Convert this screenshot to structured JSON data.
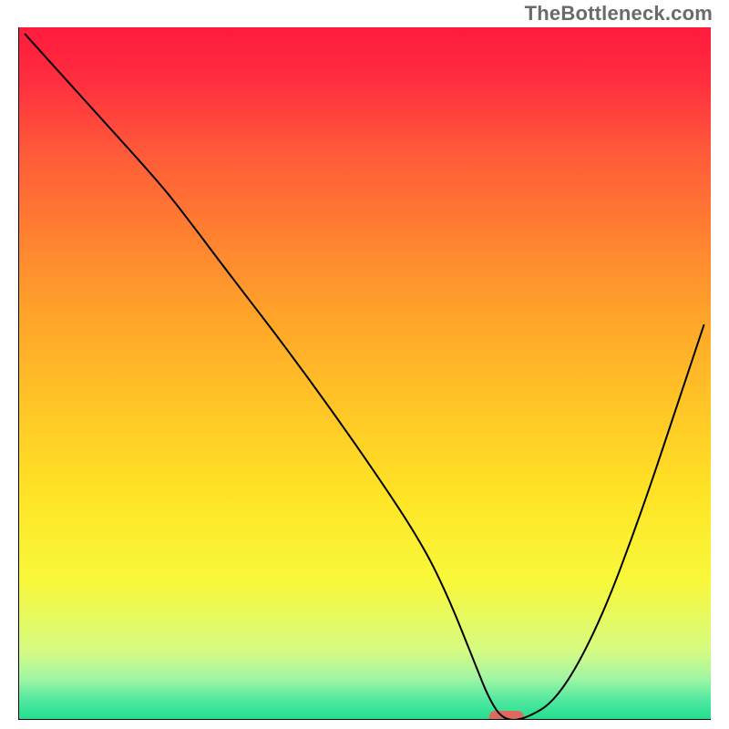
{
  "watermark": "TheBottleneck.com",
  "chart_data": {
    "type": "line",
    "title": "",
    "xlabel": "",
    "ylabel": "",
    "xlim": [
      0,
      100
    ],
    "ylim": [
      0,
      100
    ],
    "legend": false,
    "grid": false,
    "background": {
      "type": "vertical_gradient",
      "stops": [
        {
          "pos": 0.0,
          "color": "#ff1a3e"
        },
        {
          "pos": 0.08,
          "color": "#ff2f3f"
        },
        {
          "pos": 0.18,
          "color": "#ff5a39"
        },
        {
          "pos": 0.3,
          "color": "#ff8131"
        },
        {
          "pos": 0.42,
          "color": "#ffa52a"
        },
        {
          "pos": 0.55,
          "color": "#ffc626"
        },
        {
          "pos": 0.68,
          "color": "#ffe526"
        },
        {
          "pos": 0.8,
          "color": "#f8f83b"
        },
        {
          "pos": 0.9,
          "color": "#d6fb82"
        },
        {
          "pos": 0.94,
          "color": "#a1f6a4"
        },
        {
          "pos": 0.97,
          "color": "#54e9a0"
        },
        {
          "pos": 1.0,
          "color": "#1fdf8f"
        }
      ]
    },
    "series": [
      {
        "name": "bottleneck-curve",
        "color": "#000000",
        "x": [
          1,
          10,
          20,
          24,
          30,
          40,
          50,
          58,
          62,
          66,
          68,
          70,
          73,
          78,
          84,
          90,
          95,
          99
        ],
        "y": [
          99,
          89,
          78,
          73,
          65,
          52,
          38,
          26,
          18,
          8,
          3,
          0,
          0,
          3,
          14,
          30,
          45,
          57
        ]
      }
    ],
    "marker": {
      "name": "optimal-point",
      "x_start": 68,
      "x_end": 73,
      "y": 0,
      "color": "#e0695f",
      "shape": "rounded-bar"
    },
    "axes": {
      "show_border": true,
      "border_sides": [
        "left",
        "bottom"
      ],
      "border_color": "#000000",
      "border_width": 2
    }
  }
}
